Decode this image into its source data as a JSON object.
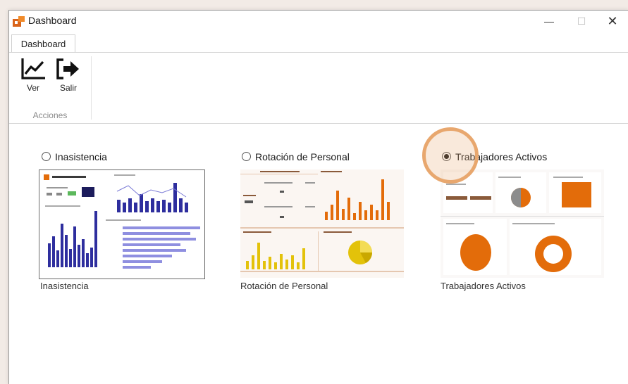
{
  "window": {
    "title": "Dashboard",
    "controls": {
      "minimize": "—",
      "maximize": "☐",
      "close": "✕"
    }
  },
  "ribbon": {
    "tab": "Dashboard",
    "group_label": "Acciones",
    "buttons": [
      {
        "label": "Ver",
        "icon": "line-chart-icon"
      },
      {
        "label": "Salir",
        "icon": "exit-icon"
      }
    ]
  },
  "dashboards": [
    {
      "label": "Inasistencia",
      "caption": "Inasistencia",
      "selected": false
    },
    {
      "label": "Rotación de Personal",
      "caption": "Rotación de Personal",
      "selected": false
    },
    {
      "label": "Trabajadores Activos",
      "caption": "Trabajadores Activos",
      "selected": true
    }
  ],
  "colors": {
    "accent_orange": "#e36c0a",
    "indigo": "#2e2e9e",
    "gold": "#e3c20a",
    "highlight": "#e8a76e"
  }
}
